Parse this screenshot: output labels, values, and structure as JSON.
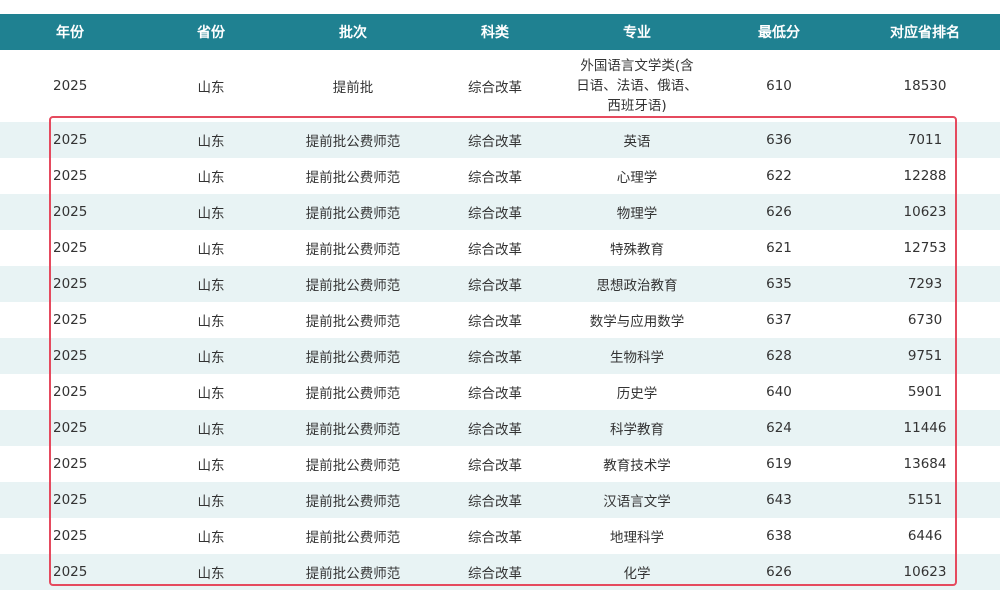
{
  "table": {
    "headers": [
      "年份",
      "省份",
      "批次",
      "科类",
      "专业",
      "最低分",
      "对应省排名"
    ],
    "rows": [
      {
        "year": "2025",
        "province": "山东",
        "batch": "提前批",
        "type": "综合改革",
        "major": "外国语言文学类(含日语、法语、俄语、西班牙语)",
        "min": "610",
        "rank": "18530"
      },
      {
        "year": "2025",
        "province": "山东",
        "batch": "提前批公费师范",
        "type": "综合改革",
        "major": "英语",
        "min": "636",
        "rank": "7011"
      },
      {
        "year": "2025",
        "province": "山东",
        "batch": "提前批公费师范",
        "type": "综合改革",
        "major": "心理学",
        "min": "622",
        "rank": "12288"
      },
      {
        "year": "2025",
        "province": "山东",
        "batch": "提前批公费师范",
        "type": "综合改革",
        "major": "物理学",
        "min": "626",
        "rank": "10623"
      },
      {
        "year": "2025",
        "province": "山东",
        "batch": "提前批公费师范",
        "type": "综合改革",
        "major": "特殊教育",
        "min": "621",
        "rank": "12753"
      },
      {
        "year": "2025",
        "province": "山东",
        "batch": "提前批公费师范",
        "type": "综合改革",
        "major": "思想政治教育",
        "min": "635",
        "rank": "7293"
      },
      {
        "year": "2025",
        "province": "山东",
        "batch": "提前批公费师范",
        "type": "综合改革",
        "major": "数学与应用数学",
        "min": "637",
        "rank": "6730"
      },
      {
        "year": "2025",
        "province": "山东",
        "batch": "提前批公费师范",
        "type": "综合改革",
        "major": "生物科学",
        "min": "628",
        "rank": "9751"
      },
      {
        "year": "2025",
        "province": "山东",
        "batch": "提前批公费师范",
        "type": "综合改革",
        "major": "历史学",
        "min": "640",
        "rank": "5901"
      },
      {
        "year": "2025",
        "province": "山东",
        "batch": "提前批公费师范",
        "type": "综合改革",
        "major": "科学教育",
        "min": "624",
        "rank": "11446"
      },
      {
        "year": "2025",
        "province": "山东",
        "batch": "提前批公费师范",
        "type": "综合改革",
        "major": "教育技术学",
        "min": "619",
        "rank": "13684"
      },
      {
        "year": "2025",
        "province": "山东",
        "batch": "提前批公费师范",
        "type": "综合改革",
        "major": "汉语言文学",
        "min": "643",
        "rank": "5151"
      },
      {
        "year": "2025",
        "province": "山东",
        "batch": "提前批公费师范",
        "type": "综合改革",
        "major": "地理科学",
        "min": "638",
        "rank": "6446"
      },
      {
        "year": "2025",
        "province": "山东",
        "batch": "提前批公费师范",
        "type": "综合改革",
        "major": "化学",
        "min": "626",
        "rank": "10623"
      }
    ]
  },
  "colors": {
    "header_bg": "#1f8191",
    "header_text": "#ffffff",
    "stripe_bg": "#e8f3f4",
    "highlight_border": "#e54a5e"
  }
}
